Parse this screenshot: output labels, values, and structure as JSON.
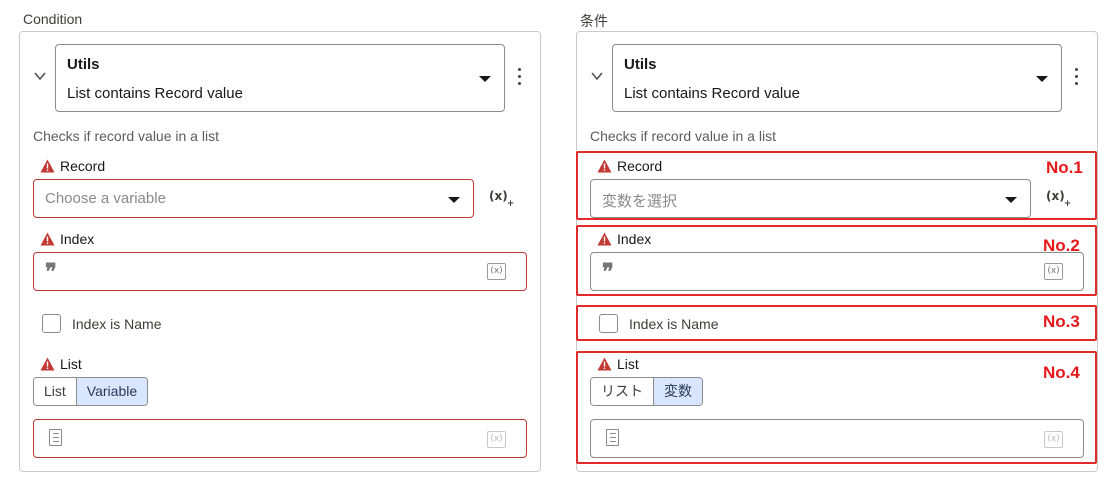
{
  "left": {
    "section_label": "Condition",
    "selector_title": "Utils",
    "selector_sub": "List contains Record value",
    "description": "Checks if record value in a list",
    "record_label": "Record",
    "record_placeholder": "Choose a variable",
    "index_label": "Index",
    "checkbox_label": "Index is Name",
    "list_label": "List",
    "toggle_list": "List",
    "toggle_variable": "Variable"
  },
  "right": {
    "section_label": "条件",
    "selector_title": "Utils",
    "selector_sub": "List contains Record value",
    "description": "Checks if record value in a list",
    "record_label": "Record",
    "record_placeholder": "変数を選択",
    "index_label": "Index",
    "checkbox_label": "Index is Name",
    "list_label": "List",
    "toggle_list": "リスト",
    "toggle_variable": "変数"
  },
  "annotations": [
    "No.1",
    "No.2",
    "No.3",
    "No.4"
  ],
  "icons": {
    "fx_label": "(x)",
    "fx_plus": "+",
    "quote": "❞"
  },
  "colors": {
    "error": "#c23934",
    "annotation": "#e32a2a",
    "toggle_active": "#d8e6fe"
  }
}
